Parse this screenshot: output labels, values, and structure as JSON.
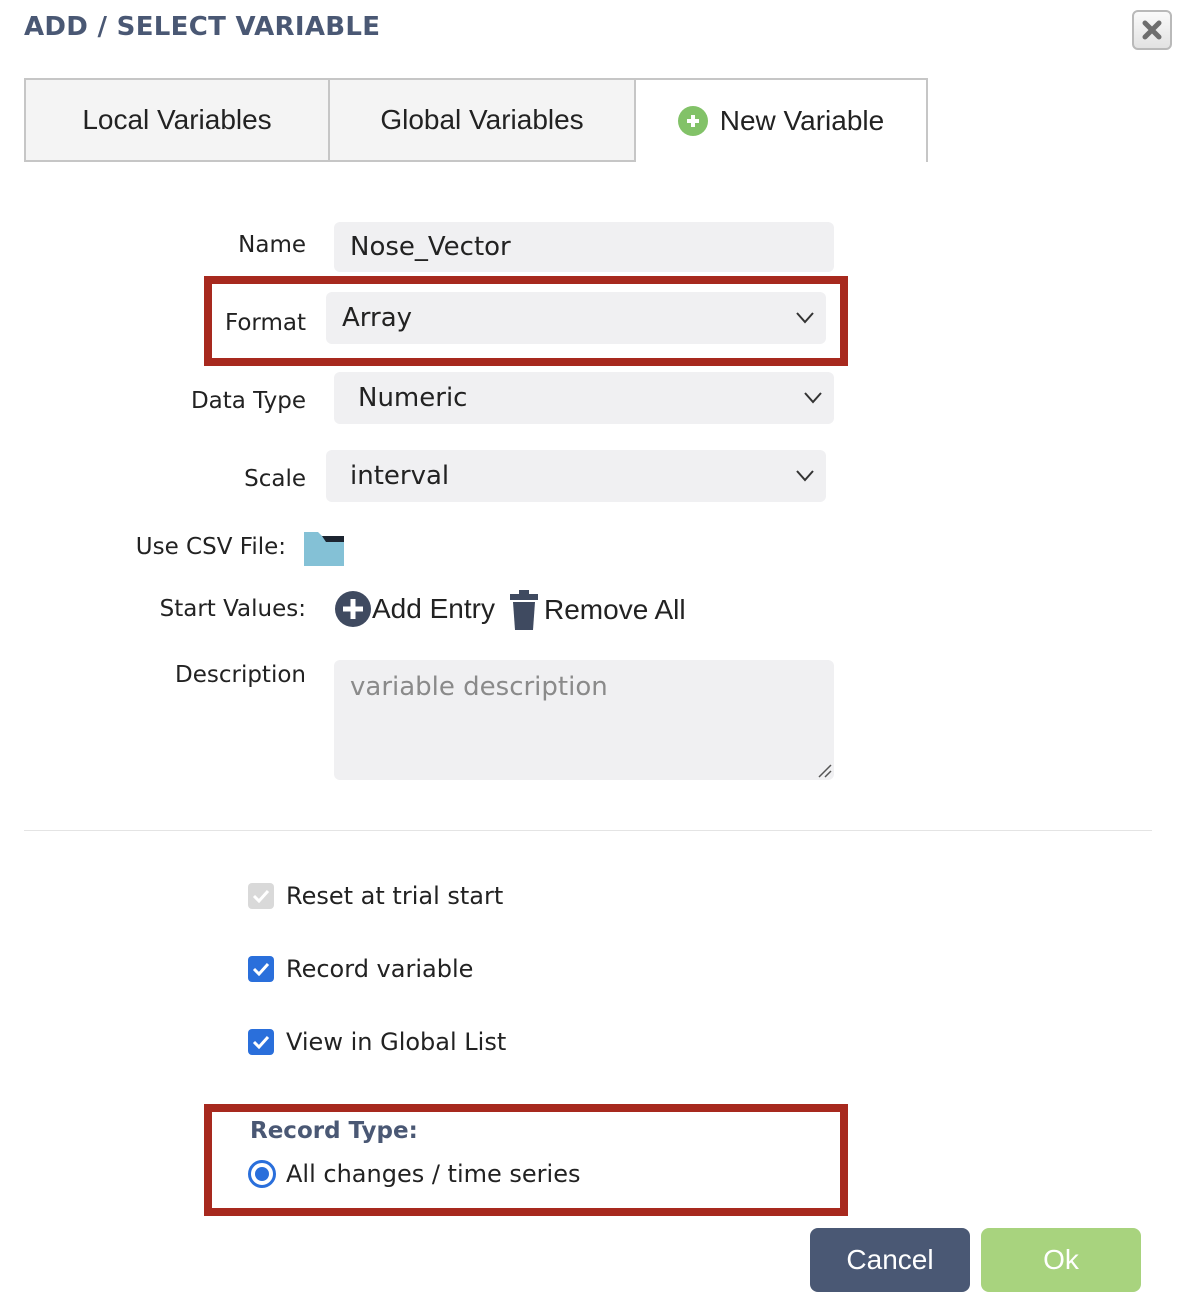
{
  "dialog": {
    "title": "ADD / SELECT VARIABLE"
  },
  "tabs": [
    {
      "label": "Local Variables",
      "active": false
    },
    {
      "label": "Global Variables",
      "active": false
    },
    {
      "label": "New Variable",
      "active": true,
      "icon": "plus-circle-icon"
    }
  ],
  "form": {
    "name_label": "Name",
    "name_value": "Nose_Vector",
    "format_label": "Format",
    "format_value": "Array",
    "data_type_label": "Data Type",
    "data_type_value": "Numeric",
    "scale_label": "Scale",
    "scale_value": "interval",
    "csv_label": "Use CSV File:",
    "start_values_label": "Start Values:",
    "add_entry_label": "Add Entry",
    "remove_all_label": "Remove All",
    "description_label": "Description",
    "description_placeholder": "variable description"
  },
  "options": {
    "reset_label": "Reset at trial start",
    "reset_checked": true,
    "reset_disabled": true,
    "record_label": "Record variable",
    "record_checked": true,
    "global_list_label": "View in Global List",
    "global_list_checked": true
  },
  "record_type": {
    "title": "Record Type:",
    "option_label": "All changes / time series",
    "selected": true
  },
  "buttons": {
    "cancel": "Cancel",
    "ok": "Ok"
  },
  "colors": {
    "title": "#4a5874",
    "highlight_border": "#a7291e",
    "cancel_bg": "#4a5874",
    "ok_bg": "#a8d37e",
    "checkbox": "#2a6fdb"
  }
}
